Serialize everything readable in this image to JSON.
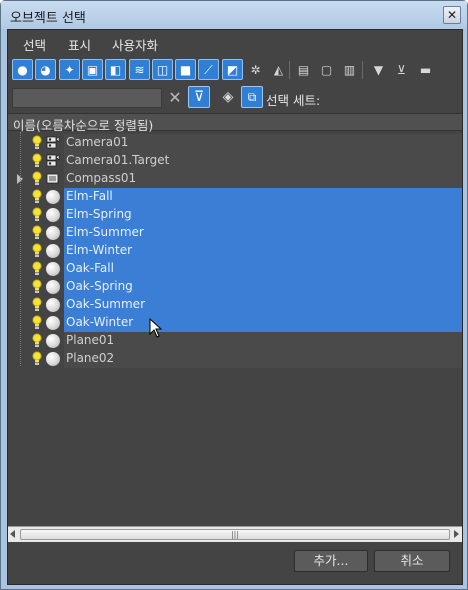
{
  "window": {
    "title": "오브젝트 선택",
    "close_glyph": "✕"
  },
  "menu": [
    "선택",
    "표시",
    "사용자화"
  ],
  "toolbar": {
    "buttons": [
      {
        "name": "geometry-filter-icon",
        "glyph": "●",
        "active": true
      },
      {
        "name": "shapes-filter-icon",
        "glyph": "◕",
        "active": true
      },
      {
        "name": "lights-filter-icon",
        "glyph": "✦",
        "active": true
      },
      {
        "name": "cameras-filter-icon",
        "glyph": "▣",
        "active": true
      },
      {
        "name": "helpers-filter-icon",
        "glyph": "◧",
        "active": true
      },
      {
        "name": "spacewarps-filter-icon",
        "glyph": "≋",
        "active": true
      },
      {
        "name": "groups-filter-icon",
        "glyph": "◫",
        "active": true
      },
      {
        "name": "xrefs-filter-icon",
        "glyph": "■",
        "active": true
      },
      {
        "name": "bones-filter-icon",
        "glyph": "⟋",
        "active": true
      },
      {
        "name": "containers-filter-icon",
        "glyph": "◩",
        "active": true
      },
      {
        "name": "frozen-filter-icon",
        "glyph": "✲",
        "active": false
      },
      {
        "name": "hidden-filter-icon",
        "glyph": "◭",
        "active": false
      },
      {
        "name": "select-all-icon",
        "glyph": "▤",
        "active": false
      },
      {
        "name": "select-none-icon",
        "glyph": "▢",
        "active": false
      },
      {
        "name": "select-invert-icon",
        "glyph": "▥",
        "active": false
      },
      {
        "name": "filter-icon",
        "glyph": "▼",
        "active": false
      },
      {
        "name": "filter-options-icon",
        "glyph": "⊻",
        "active": false
      },
      {
        "name": "display-options-icon",
        "glyph": "▬",
        "active": false
      }
    ]
  },
  "search": {
    "value": "",
    "clear_glyph": "✕"
  },
  "selection_set_label": "선택 세트:",
  "column_header": "이름(오름차순으로 정렬됨)",
  "objects": [
    {
      "name": "Camera01",
      "icon": "camera",
      "selected": false
    },
    {
      "name": "Camera01.Target",
      "icon": "camera",
      "selected": false
    },
    {
      "name": "Compass01",
      "icon": "helper",
      "selected": false,
      "expandable": true
    },
    {
      "name": "Elm-Fall",
      "icon": "sphere",
      "selected": true
    },
    {
      "name": "Elm-Spring",
      "icon": "sphere",
      "selected": true
    },
    {
      "name": "Elm-Summer",
      "icon": "sphere",
      "selected": true
    },
    {
      "name": "Elm-Winter",
      "icon": "sphere",
      "selected": true
    },
    {
      "name": "Oak-Fall",
      "icon": "sphere",
      "selected": true
    },
    {
      "name": "Oak-Spring",
      "icon": "sphere",
      "selected": true
    },
    {
      "name": "Oak-Summer",
      "icon": "sphere",
      "selected": true
    },
    {
      "name": "Oak-Winter",
      "icon": "sphere",
      "selected": true
    },
    {
      "name": "Plane01",
      "icon": "sphere",
      "selected": false
    },
    {
      "name": "Plane02",
      "icon": "sphere",
      "selected": false
    }
  ],
  "scrollbar_grip": "|||",
  "buttons": {
    "add": "추가...",
    "cancel": "취소"
  },
  "colors": {
    "selection": "#3a7fd5",
    "panel": "#444444",
    "active_tool": "#2f7fd6"
  }
}
